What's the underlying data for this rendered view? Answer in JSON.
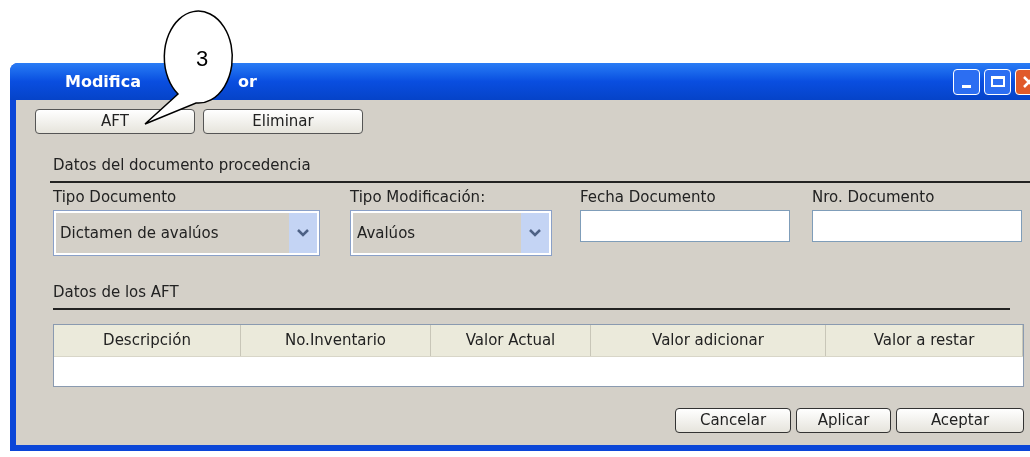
{
  "window": {
    "title_parts": [
      "Modifica",
      "or"
    ]
  },
  "callout": {
    "label": "3"
  },
  "toolbar": [
    "AFT",
    "Eliminar"
  ],
  "document_section": {
    "title": "Datos del documento procedencia",
    "fields": [
      {
        "kind": "combo",
        "label": "Tipo Documento",
        "value": "Dictamen de avalúos"
      },
      {
        "kind": "combo",
        "label": "Tipo Modificación:",
        "value": "Avalúos"
      },
      {
        "kind": "text",
        "label": "Fecha Documento"
      },
      {
        "kind": "text",
        "label": "Nro. Documento"
      }
    ]
  },
  "aft_section": {
    "title": "Datos de los AFT",
    "table": {
      "columns": [
        "Descripción",
        "No.Inventario",
        "Valor Actual",
        "Valor adicionar",
        "Valor a restar"
      ]
    }
  },
  "buttons": [
    "Cancelar",
    "Aplicar",
    "Aceptar"
  ]
}
